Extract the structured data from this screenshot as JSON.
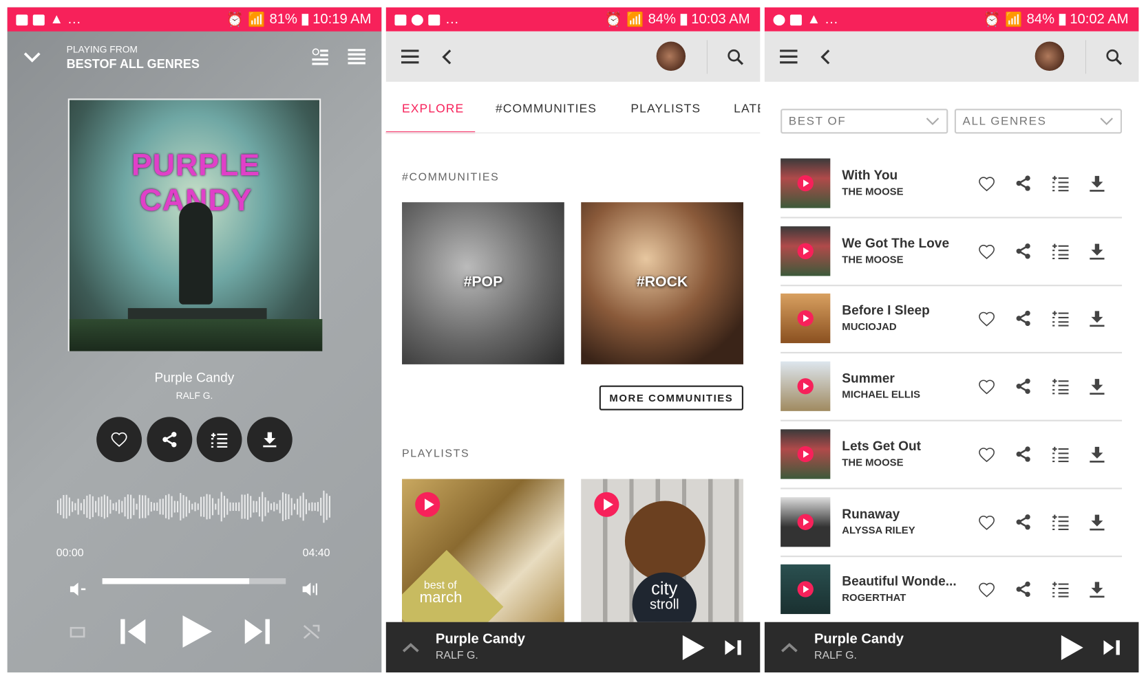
{
  "colors": {
    "accent": "#f7215a",
    "mini_player": "#2b2b2b"
  },
  "status_bars": [
    {
      "battery": "81%",
      "time": "10:19 AM"
    },
    {
      "battery": "84%",
      "time": "10:03 AM"
    },
    {
      "battery": "84%",
      "time": "10:02 AM"
    }
  ],
  "now_playing": {
    "playing_from_label": "PLAYING FROM",
    "source": "BESTOF ALL GENRES",
    "album_art_text": "PURPLE CANDY",
    "title": "Purple Candy",
    "artist": "RALF G.",
    "elapsed": "00:00",
    "duration": "04:40",
    "progress_fraction": 0.8,
    "actions": [
      "favorite",
      "share",
      "add-to-queue",
      "download"
    ]
  },
  "explore": {
    "tabs": [
      {
        "label": "EXPLORE",
        "active": true
      },
      {
        "label": "#COMMUNITIES"
      },
      {
        "label": "PLAYLISTS"
      },
      {
        "label": "LATE"
      }
    ],
    "communities_label": "#COMMUNITIES",
    "communities": [
      {
        "label": "#POP"
      },
      {
        "label": "#ROCK"
      }
    ],
    "more_communities": "MORE COMMUNITIES",
    "playlists_label": "PLAYLISTS",
    "playlists": [
      {
        "line1": "best of",
        "line2": "march"
      },
      {
        "line1": "city",
        "line2": "stroll"
      }
    ]
  },
  "charts": {
    "filter1": "BEST OF",
    "filter2": "ALL GENRES",
    "tracks": [
      {
        "title": "With You",
        "artist": "THE MOOSE"
      },
      {
        "title": "We Got The Love",
        "artist": "THE MOOSE"
      },
      {
        "title": "Before I Sleep",
        "artist": "MUCIOJAD"
      },
      {
        "title": "Summer",
        "artist": "MICHAEL ELLIS"
      },
      {
        "title": "Lets Get Out",
        "artist": "THE MOOSE"
      },
      {
        "title": "Runaway",
        "artist": "ALYSSA RILEY"
      },
      {
        "title": "Beautiful Wonde...",
        "artist": "ROGERTHAT"
      }
    ]
  },
  "mini_player": {
    "title": "Purple Candy",
    "artist": "RALF G."
  }
}
